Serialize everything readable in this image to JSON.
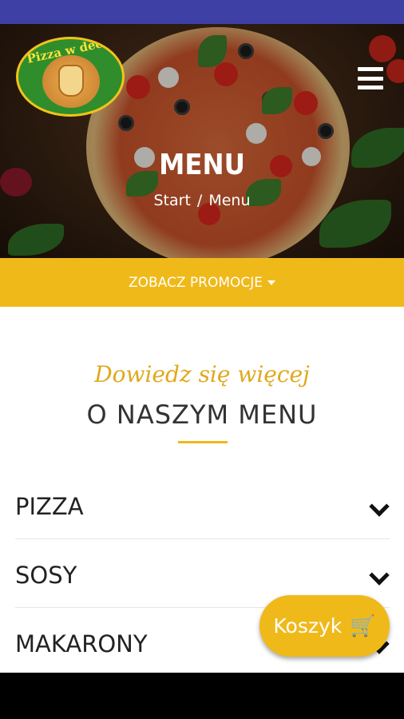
{
  "header": {
    "logo_text": "Pizza w dechę",
    "title": "MENU",
    "breadcrumb": {
      "home": "Start",
      "separator": "/",
      "current": "Menu"
    }
  },
  "promo": {
    "label": "ZOBACZ PROMOCJE"
  },
  "intro": {
    "script": "Dowiedz się więcej",
    "title": "O NASZYM MENU"
  },
  "menu_categories": [
    {
      "label": "PIZZA"
    },
    {
      "label": "SOSY"
    },
    {
      "label": "MAKARONY"
    }
  ],
  "cart": {
    "label": "Koszyk",
    "icon": "cart-icon"
  },
  "colors": {
    "accent": "#f0b91a",
    "status_bar": "#3f40a6",
    "text_dark": "#333333"
  }
}
